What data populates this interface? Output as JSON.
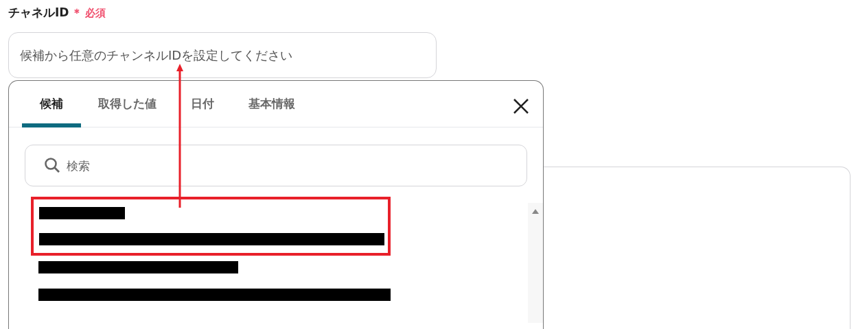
{
  "field": {
    "label": "チャネルID",
    "required_mark": "＊",
    "required_text": "必須",
    "placeholder": "候補から任意のチャンネルIDを設定してください"
  },
  "tabs": [
    {
      "label": "候補",
      "selected": true
    },
    {
      "label": "取得した値",
      "selected": false
    },
    {
      "label": "日付",
      "selected": false
    },
    {
      "label": "基本情報",
      "selected": false
    }
  ],
  "search": {
    "placeholder": "検索"
  },
  "options": [
    {
      "redacted": true,
      "highlighted": true
    },
    {
      "redacted": true,
      "highlighted": false
    }
  ]
}
